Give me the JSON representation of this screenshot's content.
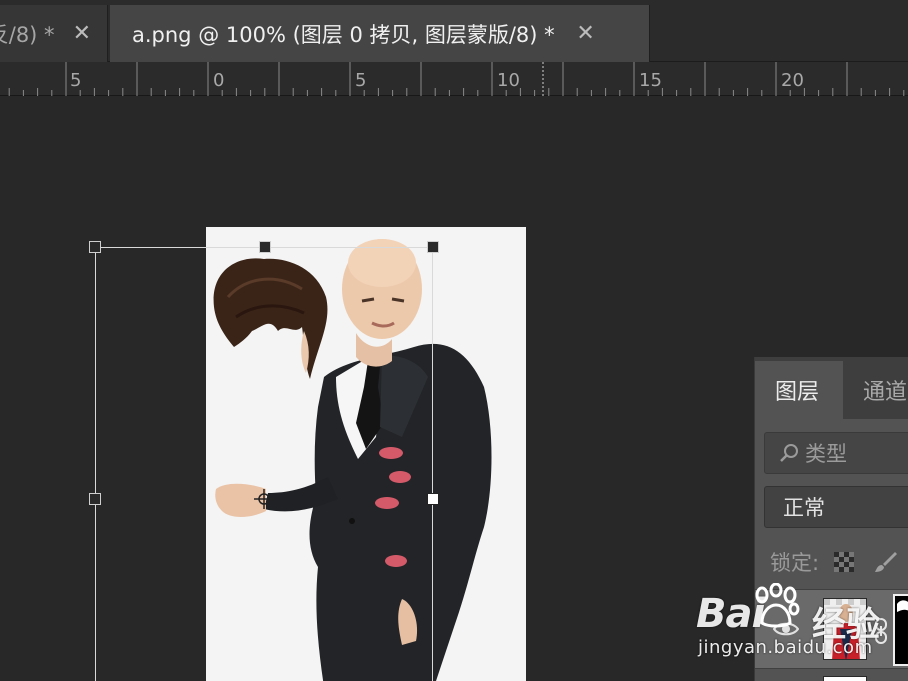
{
  "tabs": {
    "inactive_title": "反/8) *",
    "active_title": "a.png @ 100% (图层 0 拷贝, 图层蒙版/8) *",
    "close_glyph": "✕"
  },
  "ruler": {
    "labels": [
      "5",
      "0",
      "5",
      "10",
      "15",
      "20"
    ]
  },
  "layers_panel": {
    "tab_layers": "图层",
    "tab_channels": "通道",
    "search_placeholder": "类型",
    "blend_mode": "正常",
    "lock_label": "锁定:"
  },
  "watermark": {
    "brand_left": "Bai",
    "brand_right": "经验",
    "url": "jingyan.baidu.com"
  },
  "colors": {
    "app_bg": "#282828",
    "panel_bg": "#535353",
    "active_tab": "#454545",
    "canvas_bg": "#f4f4f4"
  }
}
